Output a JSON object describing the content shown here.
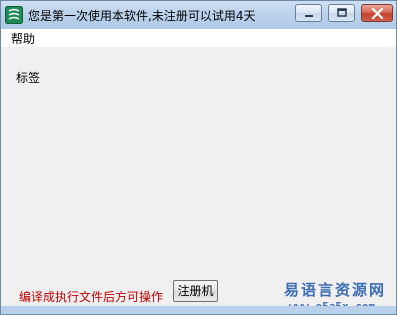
{
  "window": {
    "title": "您是第一次使用本软件,未注册可以试用4天"
  },
  "menu": {
    "items": [
      {
        "label": "帮助"
      }
    ]
  },
  "main": {
    "label": "标签",
    "warning": "编译成执行文件后方可操作",
    "register_button": "注册机"
  },
  "watermark": {
    "chinese": "易语言资源网",
    "url": "www.e5a5x.com"
  },
  "icons": {
    "app_icon": "app-icon",
    "minimize": "minimize-icon",
    "maximize": "maximize-icon",
    "close": "close-icon"
  },
  "colors": {
    "warning_text": "#c00000",
    "watermark": "#3d6fb5",
    "close_button": "#c3412c"
  }
}
